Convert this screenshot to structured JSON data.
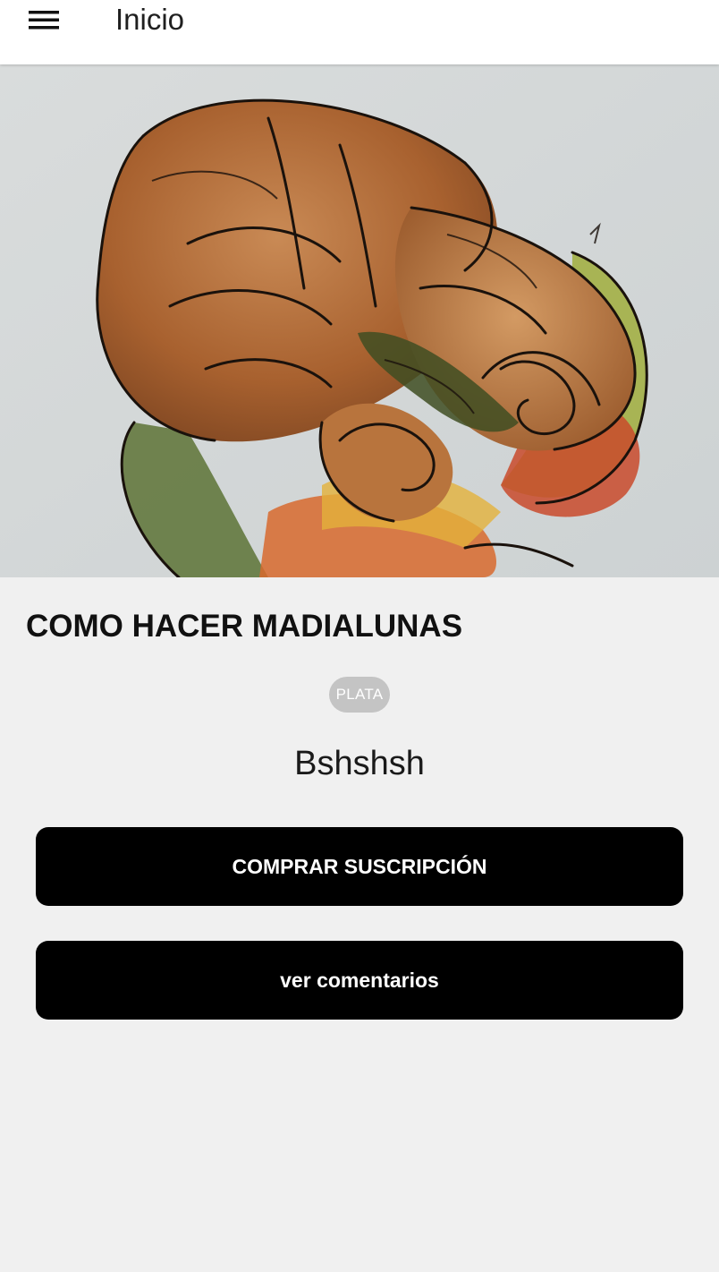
{
  "header": {
    "menu_icon": "hamburger-menu-icon",
    "title": "Inicio"
  },
  "hero": {
    "image_subject": "watercolor-croissants-illustration"
  },
  "course": {
    "title": "COMO HACER MADIALUNAS",
    "tier_badge": "PLATA",
    "description": "Bshshsh"
  },
  "actions": {
    "subscribe_label": "COMPRAR SUSCRIPCIÓN",
    "comments_label": "ver comentarios"
  },
  "colors": {
    "background": "#f0f0f0",
    "topbar": "#ffffff",
    "button": "#000000",
    "button_text": "#ffffff",
    "badge": "#c4c4c4"
  }
}
